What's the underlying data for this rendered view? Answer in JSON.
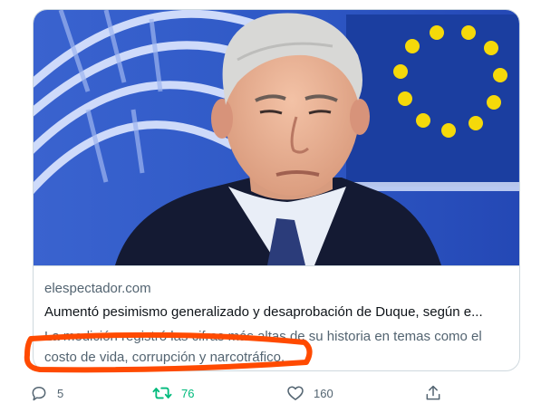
{
  "card": {
    "image_alt": "Iván Duque",
    "domain": "elespectador.com",
    "headline": "Aumentó pesimismo generalizado y desaprobación de Duque, según e...",
    "description": "La medición registró las cifras más altas de su historia en temas como el costo de vida, corrupción y narcotráfico."
  },
  "annotation": {
    "color": "#ff4a00"
  },
  "actions": {
    "reply": {
      "icon": "reply-icon",
      "count": "5"
    },
    "retweet": {
      "icon": "retweet-icon",
      "count": "76",
      "active_color": "#00ba7c"
    },
    "like": {
      "icon": "heart-icon",
      "count": "160"
    },
    "share": {
      "icon": "share-icon"
    }
  },
  "colors": {
    "text_secondary": "#536471",
    "border": "#cfd9de",
    "eu_blue": "#1b3ea0",
    "eu_star": "#f5d90a"
  }
}
